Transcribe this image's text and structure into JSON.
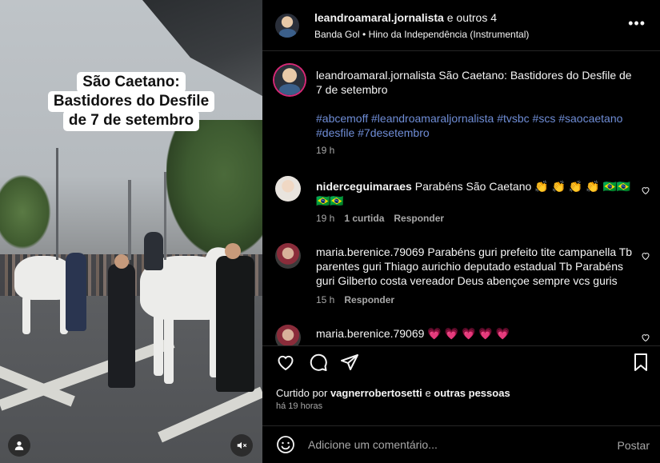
{
  "media": {
    "caption_lines": [
      "São Caetano:",
      "Bastidores do Desfile",
      "de 7 de setembro"
    ],
    "user_icon": "user-icon",
    "mute_icon": "speaker-muted-icon"
  },
  "header": {
    "username": "leandroamaral.jornalista",
    "coauthors": "e outros 4",
    "music": "Banda Gol • Hino da Independência (Instrumental)",
    "more": "•••"
  },
  "caption": {
    "username": "leandroamaral.jornalista",
    "text": "São Caetano: Bastidores do Desfile de 7 de setembro",
    "hashtags": "#abcemoff #leandroamaraljornalista #tvsbc #scs #saocaetano #desfile #7desetembro",
    "time": "19 h"
  },
  "comments": [
    {
      "username": "niderceguimaraes",
      "text": "Parabéns São Caetano 👏 👏 👏 👏 🇧🇷🇧🇷🇧🇷🇧🇷",
      "time": "19 h",
      "likes": "1 curtida",
      "reply": "Responder"
    },
    {
      "username": "maria.berenice.79069",
      "text": "Parabéns guri prefeito tite campanella Tb parentes guri Thiago aurichio deputado estadual Tb Parabéns guri Gilberto costa vereador Deus abençoe sempre vcs guris",
      "time": "15 h",
      "reply": "Responder"
    },
    {
      "username": "maria.berenice.79069",
      "text": "💗 💗 💗 💗 💗"
    }
  ],
  "likes": {
    "prefix": "Curtido por",
    "user": "vagnerrobertosetti",
    "conj": "e",
    "others": "outras pessoas",
    "time_ago": "há 19 horas"
  },
  "add_comment": {
    "placeholder": "Adicione um comentário...",
    "post": "Postar"
  },
  "colors": {
    "background": "#000000",
    "hashtag": "#6f8dd6",
    "muted_text": "#a8a8a8",
    "divider": "#262626"
  }
}
